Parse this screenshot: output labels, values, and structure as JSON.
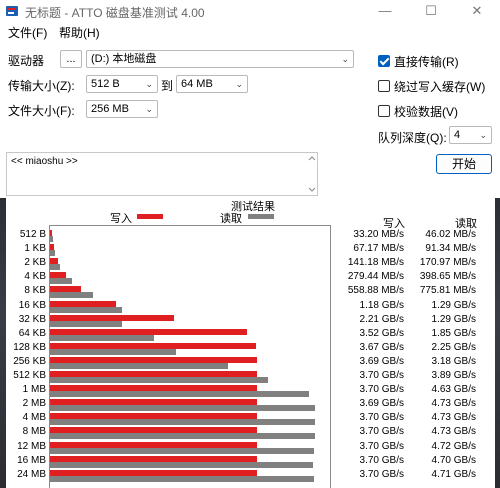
{
  "window": {
    "title": "无标题 - ATTO 磁盘基准测试 4.00",
    "minimize_glyph": "—",
    "maximize_glyph": "☐",
    "close_glyph": "✕"
  },
  "menu": {
    "items": [
      "文件(F)",
      "帮助(H)"
    ]
  },
  "settings": {
    "drive_label": "驱动器",
    "browse_label": "...",
    "drive_value": "(D:) 本地磁盘",
    "transfer_label": "传输大小(Z):",
    "transfer_from": "512 B",
    "to_label": "到",
    "transfer_to": "64 MB",
    "file_size_label": "文件大小(F):",
    "file_size": "256 MB",
    "direct_io_label": "直接传输(R)",
    "bypass_cache_label": "绕过写入缓存(W)",
    "verify_label": "校验数据(V)",
    "queue_depth_label": "队列深度(Q):",
    "queue_depth": "4",
    "start_label": "开始",
    "description_text": "<< miaoshu >>"
  },
  "colors": {
    "write": "#e02020",
    "read": "#808080",
    "accent": "#0060c0"
  },
  "chart_data": {
    "type": "bar",
    "title": "测试结果",
    "legend_write": "写入",
    "legend_read": "读取",
    "col_write": "写入",
    "col_read": "读取",
    "categories": [
      "512 B",
      "1 KB",
      "2 KB",
      "4 KB",
      "8 KB",
      "16 KB",
      "32 KB",
      "64 KB",
      "128 KB",
      "256 KB",
      "512 KB",
      "1 MB",
      "2 MB",
      "4 MB",
      "8 MB",
      "12 MB",
      "16 MB",
      "24 MB"
    ],
    "series": [
      {
        "name": "写入",
        "values_mb_s": [
          33.2,
          67.17,
          141.18,
          279.44,
          558.88,
          1180,
          2210,
          3520,
          3670,
          3690,
          3700,
          3700,
          3690,
          3700,
          3700,
          3700,
          3700,
          3700
        ]
      },
      {
        "name": "读取",
        "values_mb_s": [
          46.02,
          91.34,
          170.97,
          398.65,
          775.81,
          1290,
          1290,
          1850,
          2250,
          3180,
          3890,
          4630,
          4730,
          4730,
          4730,
          4720,
          4700,
          4710
        ]
      }
    ],
    "write_text": [
      "33.20 MB/s",
      "67.17 MB/s",
      "141.18 MB/s",
      "279.44 MB/s",
      "558.88 MB/s",
      "1.18 GB/s",
      "2.21 GB/s",
      "3.52 GB/s",
      "3.67 GB/s",
      "3.69 GB/s",
      "3.70 GB/s",
      "3.70 GB/s",
      "3.69 GB/s",
      "3.70 GB/s",
      "3.70 GB/s",
      "3.70 GB/s",
      "3.70 GB/s",
      "3.70 GB/s"
    ],
    "read_text": [
      "46.02 MB/s",
      "91.34 MB/s",
      "170.97 MB/s",
      "398.65 MB/s",
      "775.81 MB/s",
      "1.29 GB/s",
      "1.29 GB/s",
      "1.85 GB/s",
      "2.25 GB/s",
      "3.18 GB/s",
      "3.89 GB/s",
      "4.63 GB/s",
      "4.73 GB/s",
      "4.73 GB/s",
      "4.73 GB/s",
      "4.72 GB/s",
      "4.70 GB/s",
      "4.71 GB/s"
    ],
    "xlim_mb_s": [
      0,
      5000
    ],
    "grid": false
  }
}
